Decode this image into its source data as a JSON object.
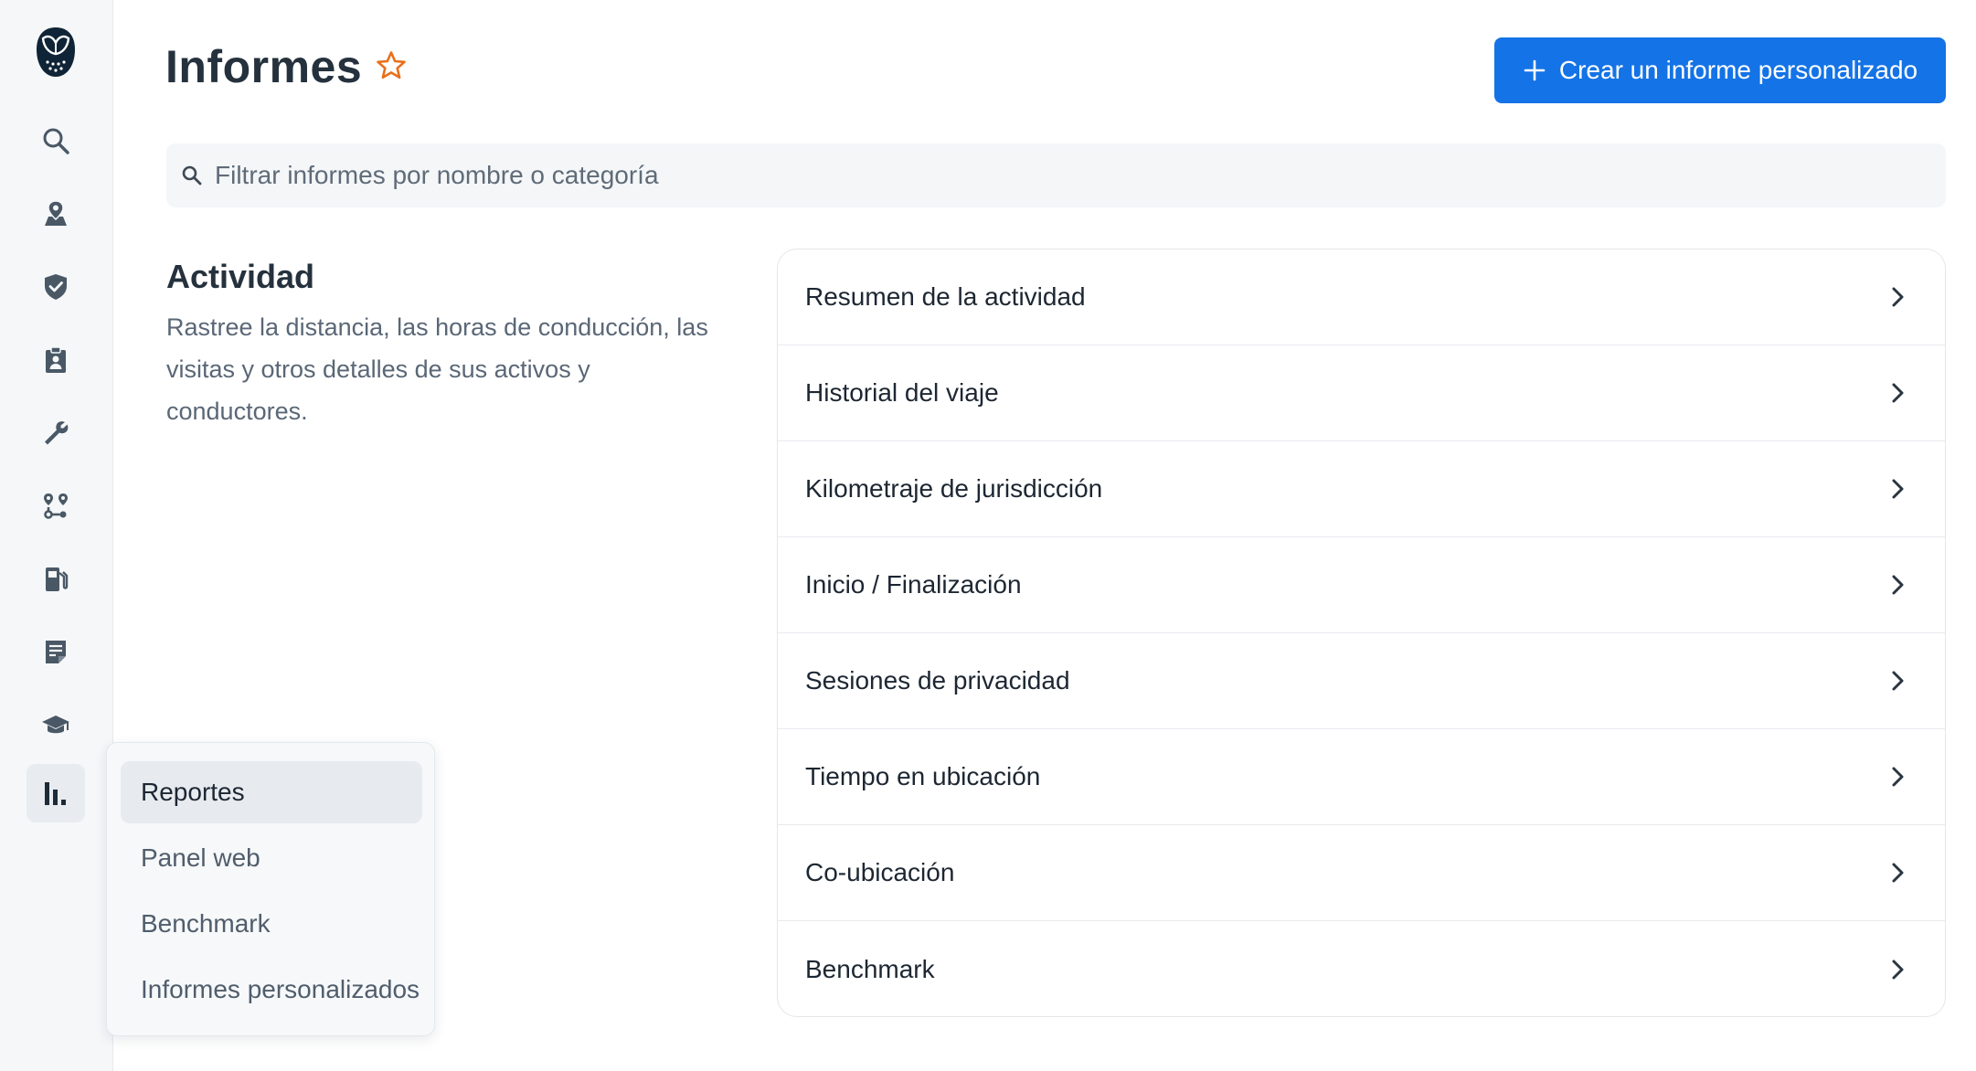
{
  "header": {
    "title": "Informes",
    "create_button": "Crear un informe personalizado"
  },
  "search": {
    "placeholder": "Filtrar informes por nombre o categoría"
  },
  "section": {
    "title": "Actividad",
    "description": "Rastree la distancia, las horas de conducción, las visitas y otros detalles de sus activos y conductores."
  },
  "reports": [
    {
      "label": "Resumen de la actividad"
    },
    {
      "label": "Historial del viaje"
    },
    {
      "label": "Kilometraje de jurisdicción"
    },
    {
      "label": "Inicio / Finalización"
    },
    {
      "label": "Sesiones de privacidad"
    },
    {
      "label": "Tiempo en ubicación"
    },
    {
      "label": "Co-ubicación"
    },
    {
      "label": "Benchmark"
    }
  ],
  "rail": {
    "items": [
      {
        "icon": "search-icon"
      },
      {
        "icon": "map-pin-icon"
      },
      {
        "icon": "shield-check-icon"
      },
      {
        "icon": "clipboard-user-icon"
      },
      {
        "icon": "wrench-icon"
      },
      {
        "icon": "route-icon"
      },
      {
        "icon": "fuel-pump-icon"
      },
      {
        "icon": "document-icon"
      },
      {
        "icon": "graduation-cap-icon"
      },
      {
        "icon": "bar-chart-icon"
      }
    ]
  },
  "flyout": {
    "items": [
      {
        "label": "Reportes",
        "active": true
      },
      {
        "label": "Panel web"
      },
      {
        "label": "Benchmark"
      },
      {
        "label": "Informes personalizados"
      }
    ]
  },
  "colors": {
    "accent": "#1473e6",
    "star": "#e8701a",
    "rail_icon": "#4a5866"
  }
}
